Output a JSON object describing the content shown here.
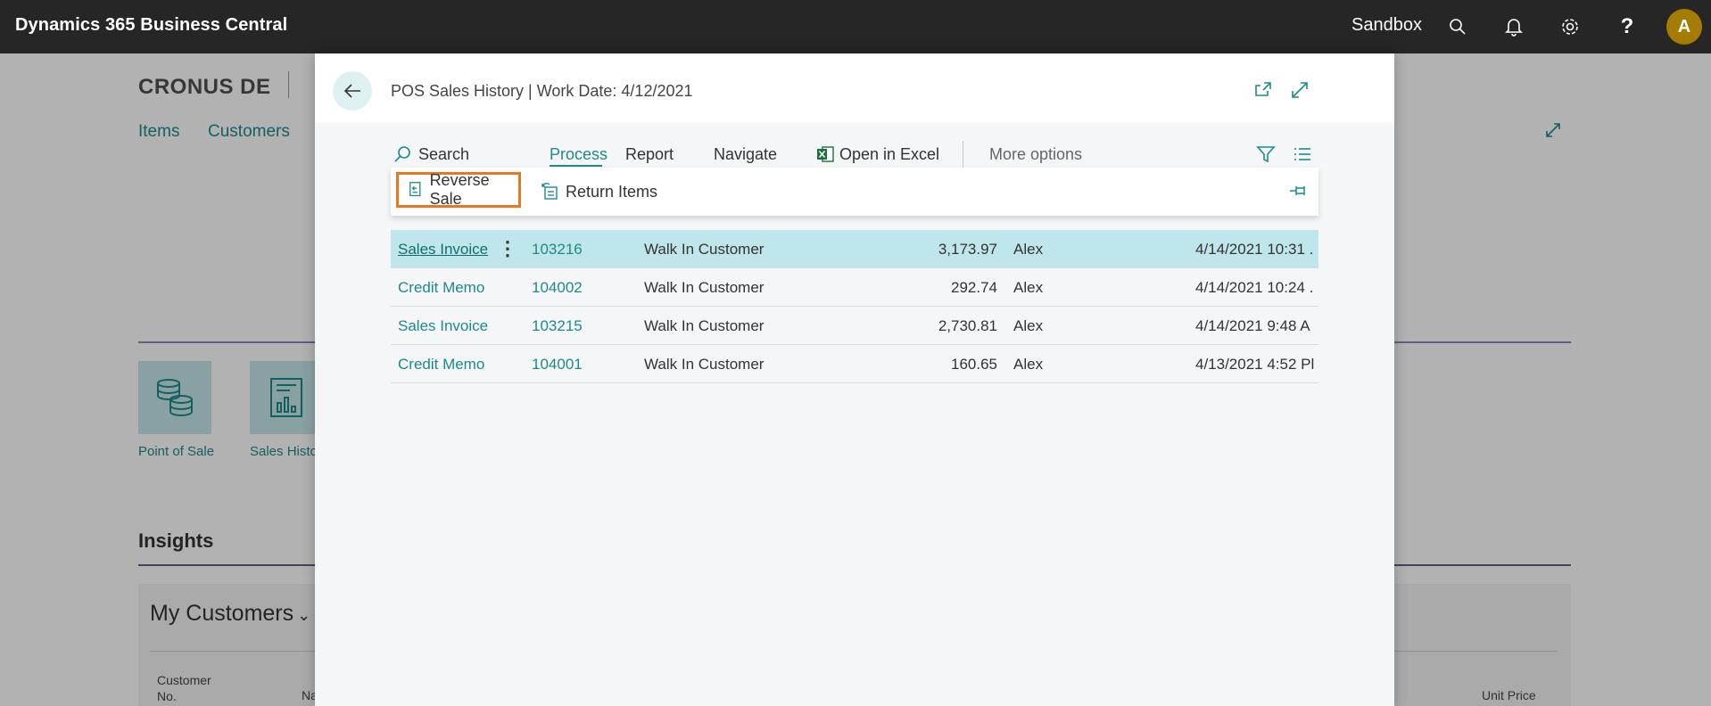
{
  "topbar": {
    "app_title": "Dynamics 365 Business Central",
    "environment": "Sandbox",
    "avatar_initial": "A",
    "icons": [
      "search-icon",
      "bell-icon",
      "gear-icon",
      "help-icon"
    ]
  },
  "background": {
    "company": "CRONUS DE",
    "nav": [
      "Items",
      "Customers"
    ],
    "tiles": [
      {
        "label": "Point of Sale",
        "icon": "coins-icon"
      },
      {
        "label": "Sales Histo",
        "icon": "report-icon"
      }
    ],
    "insights_title": "Insights",
    "my_customers_title": "My Customers",
    "columns": {
      "customer_no_1": "Customer",
      "customer_no_2": "No.",
      "name": "Na",
      "unit_price": "Unit Price"
    }
  },
  "dialog": {
    "title": "POS Sales History | Work Date: 4/12/2021",
    "actions": {
      "search": "Search",
      "process": "Process",
      "report": "Report",
      "navigate": "Navigate",
      "open_excel": "Open in Excel",
      "more": "More options"
    },
    "process_actions": {
      "reverse_sale": "Reverse Sale",
      "return_items": "Return Items"
    },
    "rows": [
      {
        "type": "Sales Invoice",
        "no": "103216",
        "customer": "Walk In Customer",
        "amount": "3,173.97",
        "staff": "Alex",
        "date": "4/14/2021 10:31 ."
      },
      {
        "type": "Credit Memo",
        "no": "104002",
        "customer": "Walk In Customer",
        "amount": "292.74",
        "staff": "Alex",
        "date": "4/14/2021 10:24 ."
      },
      {
        "type": "Sales Invoice",
        "no": "103215",
        "customer": "Walk In Customer",
        "amount": "2,730.81",
        "staff": "Alex",
        "date": "4/14/2021 9:48 A"
      },
      {
        "type": "Credit Memo",
        "no": "104001",
        "customer": "Walk In Customer",
        "amount": "160.65",
        "staff": "Alex",
        "date": "4/13/2021 4:52 Pl"
      }
    ]
  },
  "colors": {
    "accent": "#1e8a8a",
    "highlight_border": "#e87722",
    "selected_row": "#bfe6eb",
    "topbar": "#262626"
  }
}
